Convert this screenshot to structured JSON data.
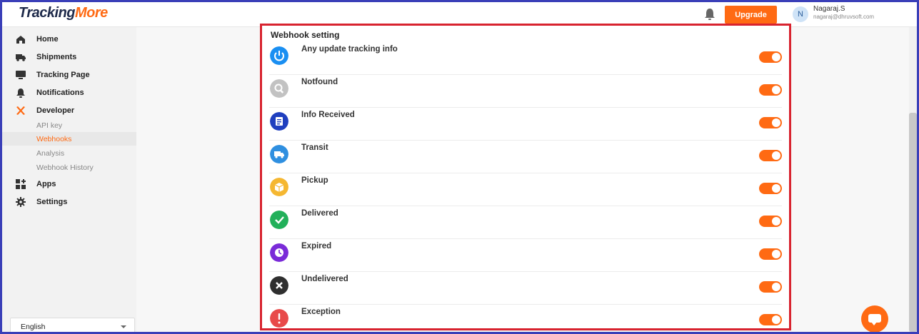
{
  "app": {
    "logo_part1": "Tracking",
    "logo_part2": "More"
  },
  "header": {
    "upgrade_label": "Upgrade",
    "user_initial": "N",
    "user_name": "Nagaraj.S",
    "user_email": "nagaraj@dhruvsoft.com"
  },
  "sidebar": {
    "items": [
      {
        "label": "Home",
        "icon": "home-icon"
      },
      {
        "label": "Shipments",
        "icon": "truck-icon"
      },
      {
        "label": "Tracking Page",
        "icon": "monitor-icon"
      },
      {
        "label": "Notifications",
        "icon": "bell-icon"
      },
      {
        "label": "Developer",
        "icon": "tools-icon"
      }
    ],
    "developer_sub": [
      {
        "label": "API key"
      },
      {
        "label": "Webhooks",
        "active": true
      },
      {
        "label": "Analysis"
      },
      {
        "label": "Webhook History"
      }
    ],
    "more_items": [
      {
        "label": "Apps",
        "icon": "apps-icon"
      },
      {
        "label": "Settings",
        "icon": "gear-icon"
      }
    ],
    "language": "English"
  },
  "webhook": {
    "title": "Webhook setting",
    "rows": [
      {
        "label": "Any update tracking info",
        "icon": "power-icon",
        "color": "#1a8ff2",
        "enabled": true
      },
      {
        "label": "Notfound",
        "icon": "search-icon",
        "color": "#c2c2c2",
        "enabled": true
      },
      {
        "label": "Info Received",
        "icon": "document-icon",
        "color": "#1f3fbf",
        "enabled": true
      },
      {
        "label": "Transit",
        "icon": "truck-icon",
        "color": "#2f8fe0",
        "enabled": true
      },
      {
        "label": "Pickup",
        "icon": "box-icon",
        "color": "#f5b731",
        "enabled": true
      },
      {
        "label": "Delivered",
        "icon": "check-icon",
        "color": "#22b05a",
        "enabled": true
      },
      {
        "label": "Expired",
        "icon": "clock-icon",
        "color": "#7a2bd8",
        "enabled": true
      },
      {
        "label": "Undelivered",
        "icon": "close-icon",
        "color": "#2f2f2f",
        "enabled": true
      },
      {
        "label": "Exception",
        "icon": "exclamation-icon",
        "color": "#e84a4a",
        "enabled": true
      }
    ]
  },
  "colors": {
    "accent": "#ff6a13",
    "panel_border": "#d8232f",
    "toggle_on": "#ff6a13"
  }
}
